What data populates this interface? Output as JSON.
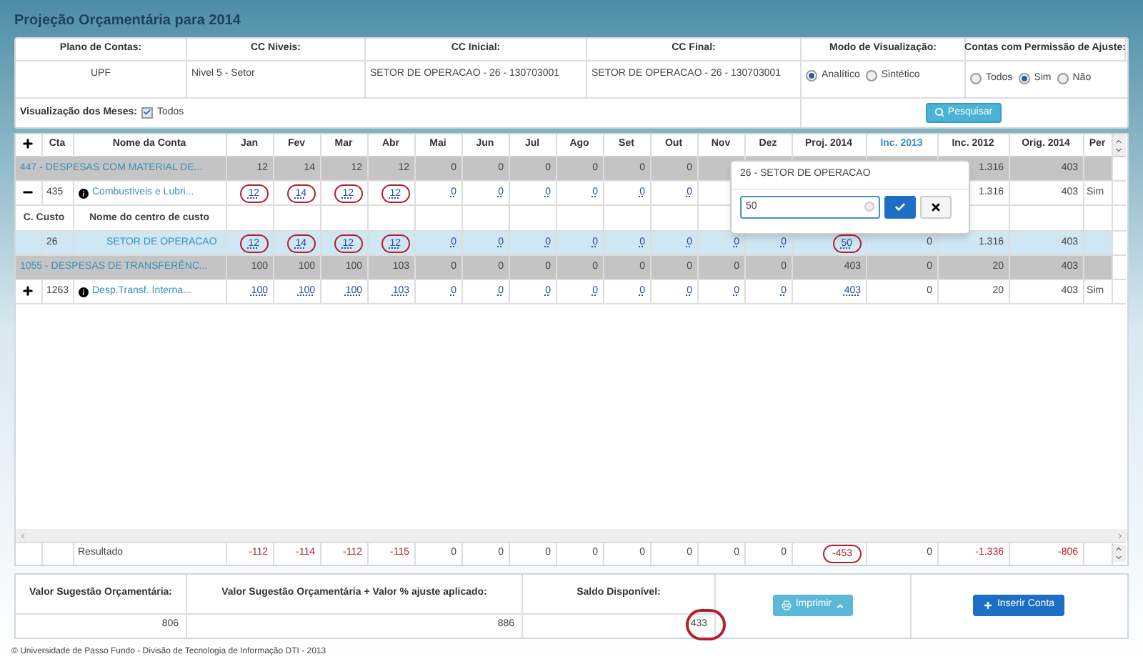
{
  "title": "Projeção Orçamentária para 2014",
  "filters": {
    "headers": [
      "Plano de Contas:",
      "CC Niveis:",
      "CC Inicial:",
      "CC Final:",
      "Modo de Visualização:",
      "Contas com Permissão de Ajuste:"
    ],
    "plano": "UPF",
    "niveis": "Nivel 5 - Setor",
    "cc_inicial": "SETOR DE OPERACAO - 26 - 130703001",
    "cc_final": "SETOR DE OPERACAO - 26 - 130703001",
    "modo": [
      {
        "label": "Analítico",
        "selected": true
      },
      {
        "label": "Sintético",
        "selected": false
      }
    ],
    "permissao": [
      {
        "label": "Todos",
        "selected": false
      },
      {
        "label": "Sim",
        "selected": true
      },
      {
        "label": "Não",
        "selected": false
      }
    ],
    "meses": {
      "label": "Visualização dos Meses:",
      "option": "Todos",
      "checked": true
    },
    "search_button": "Pesquisar"
  },
  "table": {
    "columns": [
      {
        "label": "Cta",
        "active": false
      },
      {
        "label": "Nome da Conta",
        "active": false
      },
      {
        "label": "Jan",
        "active": false
      },
      {
        "label": "Fev",
        "active": false
      },
      {
        "label": "Mar",
        "active": false
      },
      {
        "label": "Abr",
        "active": false
      },
      {
        "label": "Mai",
        "active": false
      },
      {
        "label": "Jun",
        "active": false
      },
      {
        "label": "Jul",
        "active": false
      },
      {
        "label": "Ago",
        "active": false
      },
      {
        "label": "Set",
        "active": false
      },
      {
        "label": "Out",
        "active": false
      },
      {
        "label": "Nov",
        "active": false
      },
      {
        "label": "Dez",
        "active": false
      },
      {
        "label": "Proj. 2014",
        "active": false
      },
      {
        "label": "Inc. 2013",
        "active": true
      },
      {
        "label": "Inc. 2012",
        "active": false
      },
      {
        "label": "Orig. 2014",
        "active": false
      },
      {
        "label": "Per",
        "active": false
      }
    ],
    "rows": [
      {
        "kind": "group",
        "name": "447 - DESPESAS COM MATERIAL DE...",
        "values": [
          "12",
          "14",
          "12",
          "12",
          "0",
          "0",
          "0",
          "0",
          "0",
          "0"
        ],
        "tail_values": [
          "1.316",
          "403"
        ]
      },
      {
        "kind": "account",
        "expanded": true,
        "code": "435",
        "name": "Combustiveis e Lubri...",
        "values": [
          {
            "text": "12",
            "circled": true
          },
          {
            "text": "14",
            "circled": true
          },
          {
            "text": "12",
            "circled": true
          },
          {
            "text": "12",
            "circled": true
          },
          "0",
          "0",
          "0",
          "0",
          "0",
          "0"
        ],
        "tail_values": [
          "1.316",
          "403"
        ],
        "per": "Sim"
      },
      {
        "kind": "cc_header",
        "code": "C. Custo",
        "name": "Nome do centro de custo"
      },
      {
        "kind": "cc",
        "code": "26",
        "name": "SETOR DE OPERACAO",
        "values": [
          {
            "text": "12",
            "circled": true
          },
          {
            "text": "14",
            "circled": true
          },
          {
            "text": "12",
            "circled": true
          },
          {
            "text": "12",
            "circled": true
          },
          "0",
          "0",
          "0",
          "0",
          "0",
          "0",
          "0",
          "0",
          {
            "text": "50",
            "circled": true
          },
          "0",
          "1.316",
          "403"
        ]
      },
      {
        "kind": "group",
        "name": "1055 - DESPESAS DE TRANSFERÊNC...",
        "values": [
          "100",
          "100",
          "100",
          "103",
          "0",
          "0",
          "0",
          "0",
          "0",
          "0",
          "0",
          "0",
          "403",
          "0",
          "20",
          "403"
        ]
      },
      {
        "kind": "account",
        "expanded": false,
        "code": "1263",
        "name": "Desp.Transf. Interna...",
        "values": [
          "100",
          "100",
          "100",
          "103",
          "0",
          "0",
          "0",
          "0",
          "0",
          "0",
          "0",
          "0",
          "403",
          "0",
          "20",
          "403"
        ],
        "per": "Sim"
      }
    ],
    "result": {
      "name": "Resultado",
      "values": [
        {
          "text": "-112",
          "negative": true
        },
        {
          "text": "-114",
          "negative": true
        },
        {
          "text": "-112",
          "negative": true
        },
        {
          "text": "-115",
          "negative": true
        },
        "0",
        "0",
        "0",
        "0",
        "0",
        "0",
        "0",
        "0",
        {
          "text": "-453",
          "negative": true,
          "circled": true
        },
        "0",
        {
          "text": "-1.336",
          "negative": true
        },
        {
          "text": "-806",
          "negative": true
        }
      ]
    }
  },
  "popup": {
    "title": "26 - SETOR DE OPERACAO",
    "value": "50"
  },
  "summary": {
    "headers": [
      "Valor Sugestão Orçamentária:",
      "Valor Sugestão Orçamentária + Valor % ajuste aplicado:",
      "Saldo Disponível:"
    ],
    "values": [
      {
        "text": "806",
        "circled": false
      },
      {
        "text": "886",
        "circled": false
      },
      {
        "text": "433",
        "circled": true
      }
    ],
    "print_button": "Imprimir",
    "insert_button": "Inserir Conta"
  },
  "footer": "© Universidade de Passo Fundo - Divisão de Tecnologia de Informação DTI - 2013"
}
